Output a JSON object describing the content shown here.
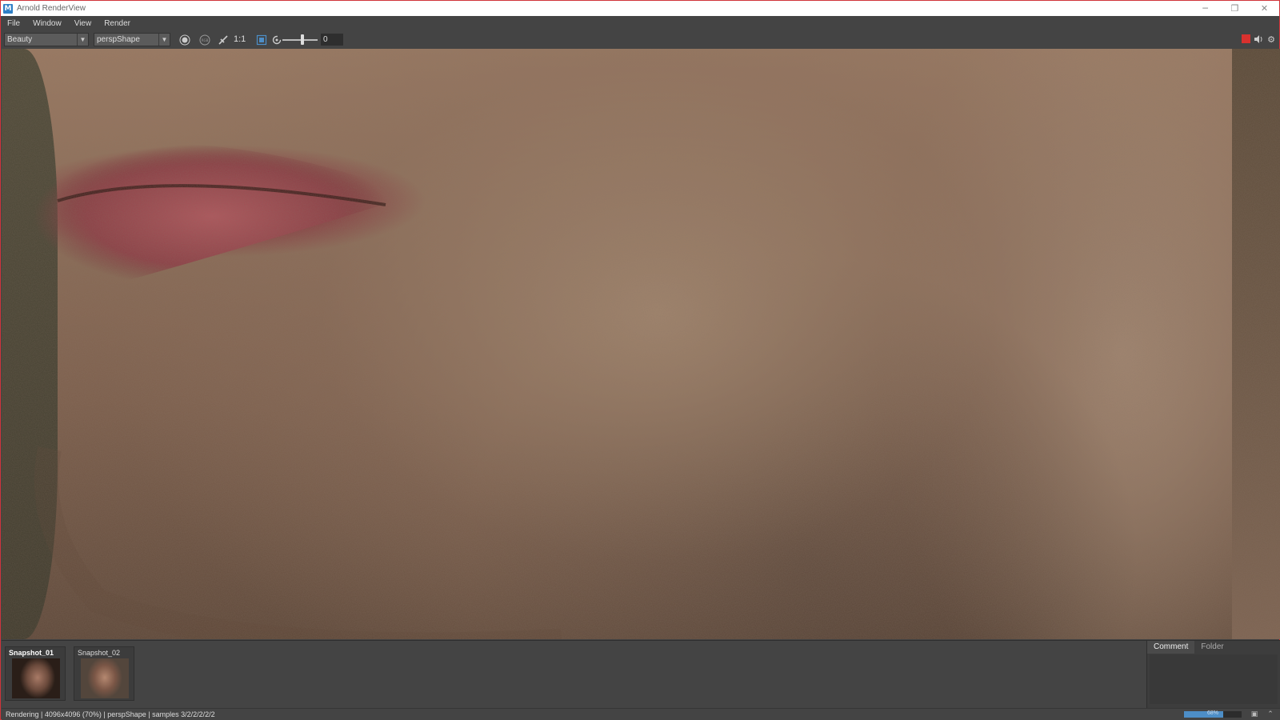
{
  "window": {
    "title": "Arnold RenderView",
    "app_icon_letter": "M",
    "minimize": "─",
    "restore": "❐",
    "close": "✕"
  },
  "menu": [
    "File",
    "Window",
    "View",
    "Render"
  ],
  "toolbar": {
    "aov": "Beauty",
    "camera": "perspShape",
    "ratio_label": "1:1",
    "frame_value": "0"
  },
  "snapshots": [
    {
      "label": "Snapshot_01"
    },
    {
      "label": "Snapshot_02"
    }
  ],
  "side_tabs": [
    "Comment",
    "Folder"
  ],
  "status": {
    "text": "Rendering | 4096x4096 (70%) | perspShape | samples 3/2/2/2/2/2",
    "progress_percent": 68,
    "progress_label": "68%"
  },
  "colors": {
    "window_border": "#d0343a",
    "progress_fill": "#4d8ec7",
    "stop_button": "#d8312e"
  }
}
